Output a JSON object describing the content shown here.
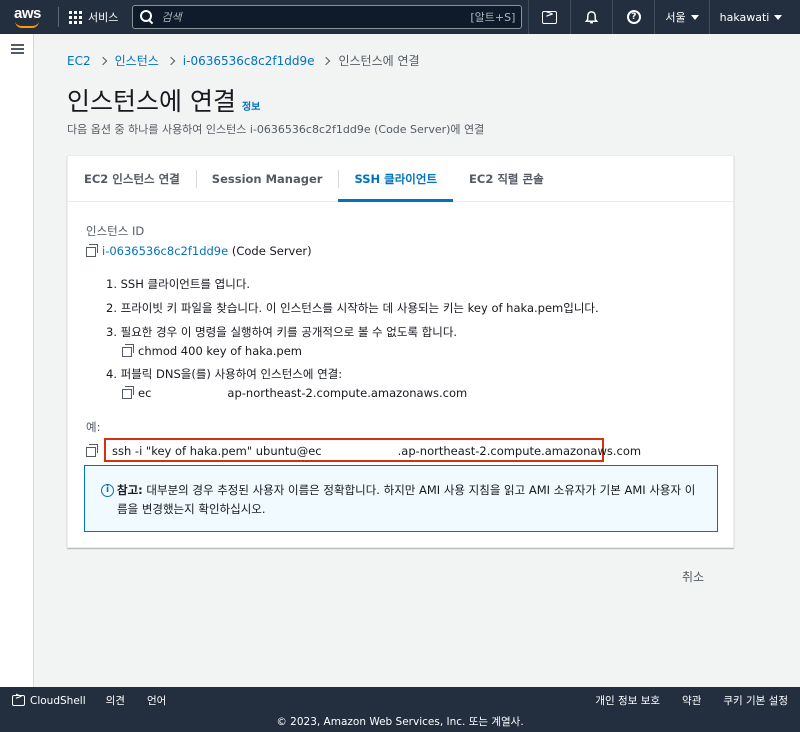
{
  "topnav": {
    "logo_text": "aws",
    "services_label": "서비스",
    "search_placeholder": "검색",
    "search_shortcut": "[알트+S]",
    "region": "서울",
    "user": "hakawati"
  },
  "breadcrumb": {
    "items": [
      "EC2",
      "인스턴스",
      "i-0636536c8c2f1dd9e"
    ],
    "current": "인스턴스에 연결"
  },
  "header": {
    "title": "인스턴스에 연결",
    "info": "정보",
    "subtitle": "다음 옵션 중 하나를 사용하여 인스턴스 i-0636536c8c2f1dd9e (Code Server)에 연결"
  },
  "tabs": [
    {
      "label": "EC2 인스턴스 연결"
    },
    {
      "label": "Session Manager"
    },
    {
      "label": "SSH 클라이언트"
    },
    {
      "label": "EC2 직렬 콘솔"
    }
  ],
  "content": {
    "instance_label": "인스턴스 ID",
    "instance_id": "i-0636536c8c2f1dd9e",
    "instance_name": "(Code Server)",
    "steps": [
      "1. SSH 클라이언트를 엽니다.",
      "2. 프라이빗 키 파일을 찾습니다. 이 인스턴스를 시작하는 데 사용되는 키는 key of haka.pem입니다.",
      "3. 필요한 경우 이 명령을 실행하여 키를 공개적으로 볼 수 없도록 합니다.",
      "4. 퍼블릭 DNS을(를) 사용하여 인스턴스에 연결:"
    ],
    "chmod_cmd": "chmod 400 key of haka.pem",
    "dns_prefix": "ec",
    "dns_suffix": "ap-northeast-2.compute.amazonaws.com",
    "example_label": "예:",
    "ssh_cmd_prefix": "ssh -i \"key of haka.pem\" ubuntu@ec",
    "ssh_cmd_suffix": ".ap-northeast-2.compute.amazonaws.com",
    "alert_bold": "참고:",
    "alert_text": "대부분의 경우 추정된 사용자 이름은 정확합니다. 하지만 AMI 사용 지침을 읽고 AMI 소유자가 기본 AMI 사용자 이름을 변경했는지 확인하십시오."
  },
  "actions": {
    "cancel": "취소"
  },
  "footer": {
    "cloudshell": "CloudShell",
    "feedback": "의견",
    "language": "언어",
    "privacy": "개인 정보 보호",
    "terms": "약관",
    "cookies": "쿠키 기본 설정",
    "copyright": "© 2023, Amazon Web Services, Inc. 또는 계열사."
  }
}
